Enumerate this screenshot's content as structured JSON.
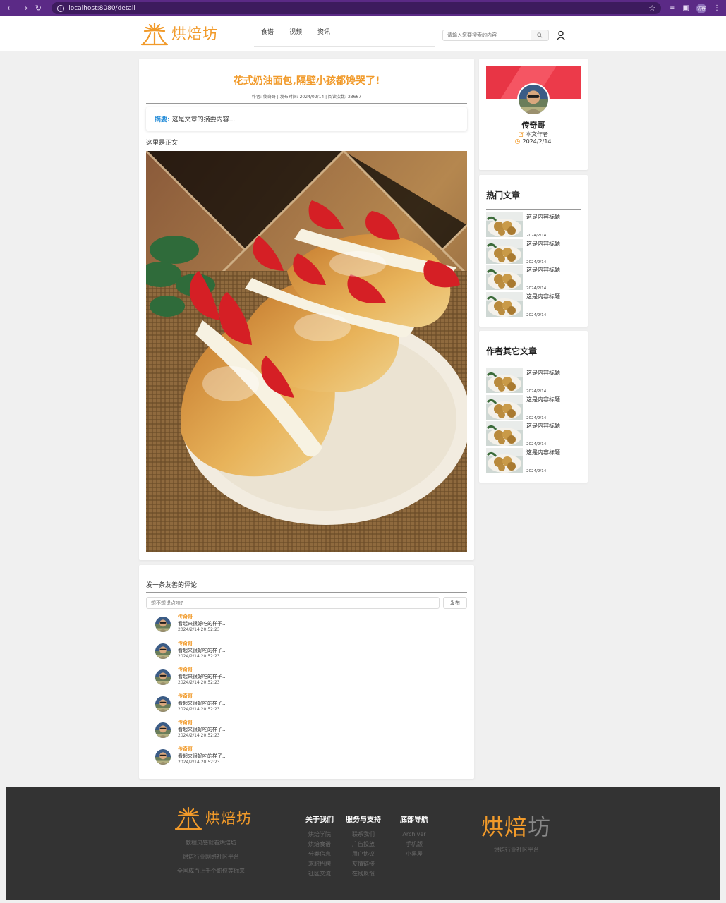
{
  "browser": {
    "url": "localhost:8080/detail",
    "profile_initials": "访客"
  },
  "header": {
    "logo_text": "烘焙坊",
    "nav": [
      "食谱",
      "视频",
      "资讯"
    ],
    "search_placeholder": "请输入您要搜索的内容"
  },
  "article": {
    "title": "花式奶油面包,隔壁小孩都馋哭了!",
    "meta": "作者: 传奇哥 | 发布时间: 2024/02/14 | 阅读次数: 23667",
    "summary_label": "摘要:",
    "summary_text": "这是文章的摘要内容...",
    "body_text": "这里是正文"
  },
  "comments": {
    "title": "发一条友善的评论",
    "input_placeholder": "想不想说点啥?",
    "submit_label": "发布",
    "items": [
      {
        "author": "传奇哥",
        "text": "看起来很好吃的样子...",
        "time": "2024/2/14 20:52:23"
      },
      {
        "author": "传奇哥",
        "text": "看起来很好吃的样子...",
        "time": "2024/2/14 20:52:23"
      },
      {
        "author": "传奇哥",
        "text": "看起来很好吃的样子...",
        "time": "2024/2/14 20:52:23"
      },
      {
        "author": "传奇哥",
        "text": "看起来很好吃的样子...",
        "time": "2024/2/14 20:52:23"
      },
      {
        "author": "传奇哥",
        "text": "看起来很好吃的样子...",
        "time": "2024/2/14 20:52:23"
      },
      {
        "author": "传奇哥",
        "text": "看起来很好吃的样子...",
        "time": "2024/2/14 20:52:23"
      }
    ]
  },
  "author_card": {
    "name": "传奇哥",
    "role": "本文作者",
    "date": "2024/2/14"
  },
  "hot_articles": {
    "title": "热门文章",
    "items": [
      {
        "title": "这是内容标题",
        "date": "2024/2/14"
      },
      {
        "title": "这是内容标题",
        "date": "2024/2/14"
      },
      {
        "title": "这是内容标题",
        "date": "2024/2/14"
      },
      {
        "title": "这是内容标题",
        "date": "2024/2/14"
      }
    ]
  },
  "other_articles": {
    "title": "作者其它文章",
    "items": [
      {
        "title": "这是内容标题",
        "date": "2024/2/14"
      },
      {
        "title": "这是内容标题",
        "date": "2024/2/14"
      },
      {
        "title": "这是内容标题",
        "date": "2024/2/14"
      },
      {
        "title": "这是内容标题",
        "date": "2024/2/14"
      }
    ]
  },
  "footer": {
    "logo_text": "烘焙坊",
    "taglines": [
      "教程灵感就看烘焙坊",
      "烘焙行业网络社区平台",
      "全国成百上千个职位等你来"
    ],
    "columns": [
      {
        "title": "关于我们",
        "links": [
          "烘焙学院",
          "烘焙食谱",
          "分类信息",
          "求职招聘",
          "社区交流"
        ]
      },
      {
        "title": "服务与支持",
        "links": [
          "联系我们",
          "广告投放",
          "用户协议",
          "友情链接",
          "在线反馈"
        ]
      },
      {
        "title": "底部导航",
        "links": [
          "Archiver",
          "手机版",
          "小黑屋"
        ]
      }
    ],
    "brand_part1": "烘焙",
    "brand_part2": "坊",
    "brand_sub": "烘焙行业社区平台"
  },
  "colors": {
    "accent": "#f19a2a",
    "browser_bar": "#5b2a86",
    "summary_label": "#2a8fd9",
    "footer_bg": "#333333"
  }
}
